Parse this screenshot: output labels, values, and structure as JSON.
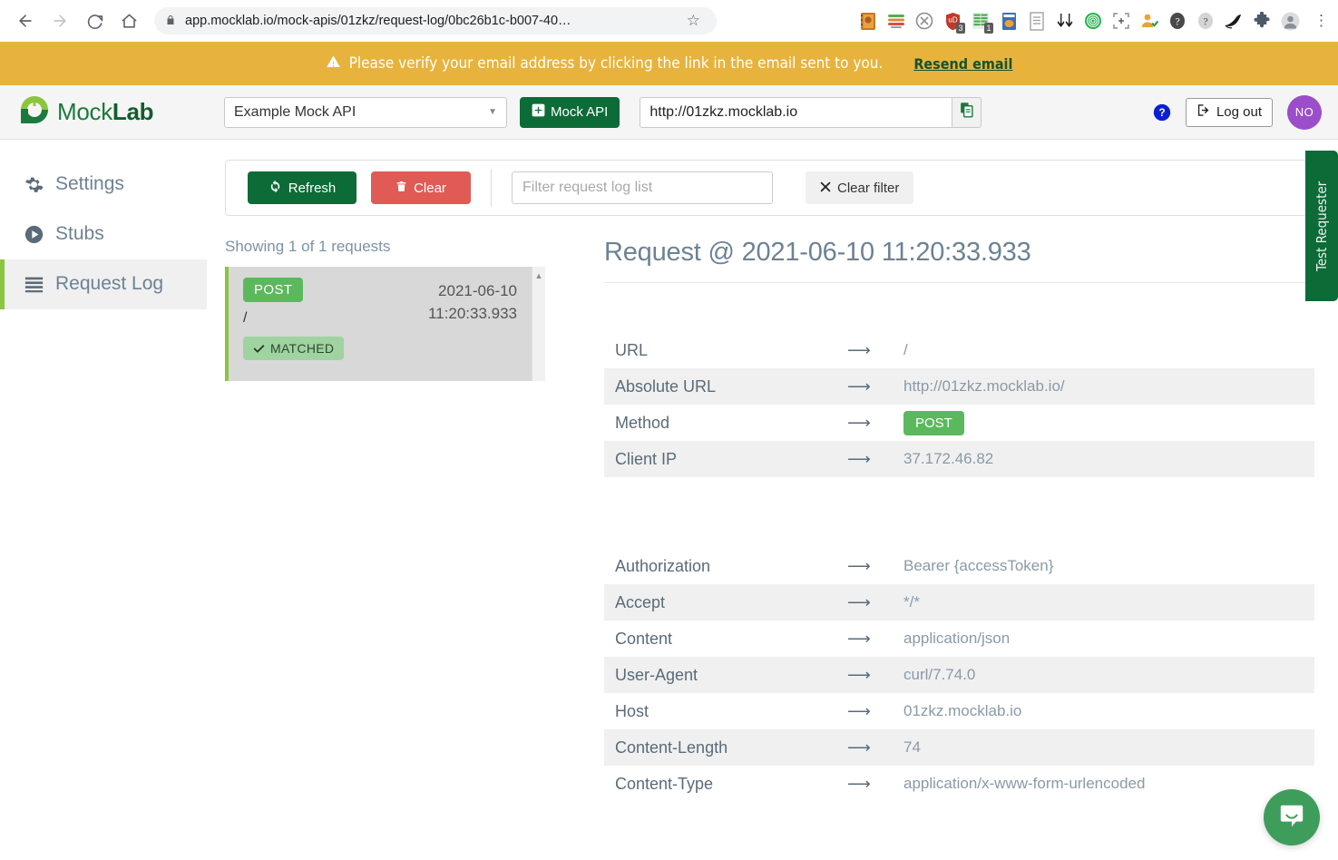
{
  "browser": {
    "back_icon": "back-arrow-icon",
    "forward_icon": "forward-arrow-icon",
    "reload_icon": "reload-icon",
    "home_icon": "home-icon",
    "lock_icon": "lock-icon",
    "url": "app.mocklab.io/mock-apis/01zkz/request-log/0bc26b1c-b007-40…",
    "star_icon": "bookmark-star-icon",
    "menu_icon": "kebab-menu-icon",
    "extensions": [
      {
        "name": "notebook-extension-icon",
        "badge": ""
      },
      {
        "name": "stripes-extension-icon",
        "badge": ""
      },
      {
        "name": "circle-extension-icon",
        "badge": ""
      },
      {
        "name": "ublock-origin-icon",
        "badge": "3"
      },
      {
        "name": "green-grid-extension-icon",
        "badge": "1"
      },
      {
        "name": "book-extension-icon",
        "badge": ""
      },
      {
        "name": "document-extension-icon",
        "badge": ""
      },
      {
        "name": "download-arrows-icon",
        "badge": ""
      },
      {
        "name": "fingerprint-extension-icon",
        "badge": ""
      },
      {
        "name": "screenshot-crop-icon",
        "badge": ""
      },
      {
        "name": "user-check-extension-icon",
        "badge": ""
      },
      {
        "name": "question-dark-extension-icon",
        "badge": ""
      },
      {
        "name": "question-light-extension-icon",
        "badge": ""
      },
      {
        "name": "bird-extension-icon",
        "badge": ""
      },
      {
        "name": "puzzle-extensions-icon",
        "badge": ""
      },
      {
        "name": "profile-avatar-icon",
        "badge": ""
      }
    ]
  },
  "banner": {
    "warning_icon": "warning-triangle-icon",
    "message": "Please verify your email address by clicking the link in the email sent to you.",
    "resend_label": "Resend email",
    "bg_color": "#e8b33c",
    "link_color": "#14532d"
  },
  "header": {
    "logo_text_light": "Mock",
    "logo_text_bold": "Lab",
    "api_selected": "Example Mock API",
    "mock_api_button": "Mock API",
    "base_url": "http://01zkz.mocklab.io",
    "copy_icon": "copy-icon",
    "help_icon": "help-circle-icon",
    "logout_label": "Log out",
    "avatar_initials": "NO",
    "avatar_color": "#9b4dca",
    "brand_green": "#0d6b38"
  },
  "sidebar": {
    "items": [
      {
        "label": "Settings",
        "icon": "gear-icon",
        "active": false
      },
      {
        "label": "Stubs",
        "icon": "play-circle-icon",
        "active": false
      },
      {
        "label": "Request Log",
        "icon": "list-icon",
        "active": true
      }
    ],
    "active_accent": "#8cc63f"
  },
  "toolbar": {
    "refresh_label": "Refresh",
    "refresh_icon": "refresh-icon",
    "clear_label": "Clear",
    "clear_icon": "trash-icon",
    "filter_placeholder": "Filter request log list",
    "filter_value": "",
    "clear_filter_label": "Clear filter",
    "clear_filter_icon": "x-icon"
  },
  "request_list": {
    "showing_text": "Showing 1 of 1 requests",
    "items": [
      {
        "method": "POST",
        "path": "/",
        "date": "2021-06-10",
        "time": "11:20:33.933",
        "status_label": "MATCHED",
        "status_icon": "check-icon",
        "selected": true
      }
    ],
    "scroll_up_icon": "scroll-up-arrow-icon"
  },
  "detail": {
    "title": "Request @ 2021-06-10 11:20:33.933",
    "arrow_glyph": "⟶",
    "summary_rows": [
      {
        "key": "URL",
        "value": "/",
        "type": "text"
      },
      {
        "key": "Absolute URL",
        "value": "http://01zkz.mocklab.io/",
        "type": "text"
      },
      {
        "key": "Method",
        "value": "POST",
        "type": "badge"
      },
      {
        "key": "Client IP",
        "value": "37.172.46.82",
        "type": "text"
      }
    ],
    "header_rows": [
      {
        "key": "Authorization",
        "value": "Bearer {accessToken}"
      },
      {
        "key": "Accept",
        "value": "*/*"
      },
      {
        "key": "Content",
        "value": "application/json"
      },
      {
        "key": "User-Agent",
        "value": "curl/7.74.0"
      },
      {
        "key": "Host",
        "value": "01zkz.mocklab.io"
      },
      {
        "key": "Content-Length",
        "value": "74"
      },
      {
        "key": "Content-Type",
        "value": "application/x-www-form-urlencoded"
      }
    ]
  },
  "test_requester": {
    "label": "Test Requester"
  },
  "intercom": {
    "icon": "intercom-chat-icon",
    "color": "#3f9d5b"
  }
}
